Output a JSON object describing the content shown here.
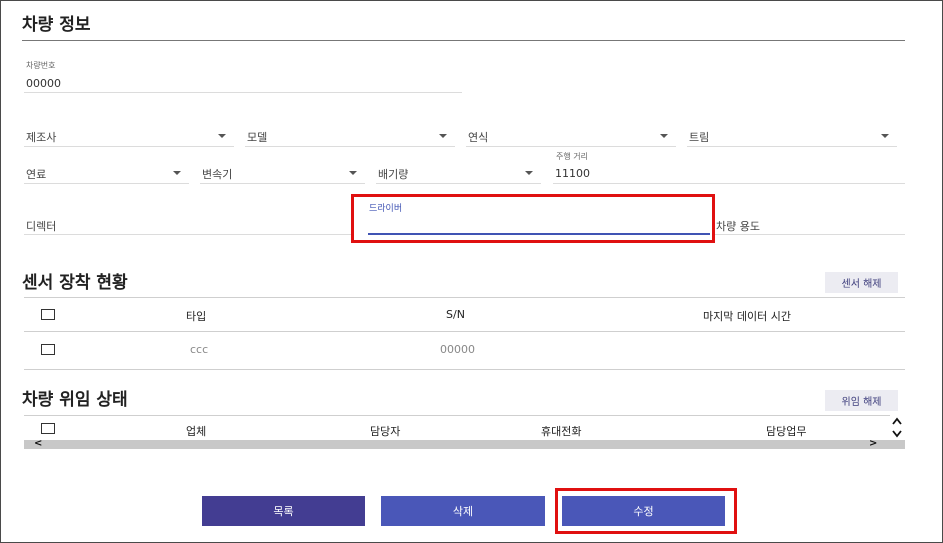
{
  "vehicle_info": {
    "title": "차량 정보",
    "plate": {
      "label": "차량번호",
      "value": "00000"
    },
    "manufacturer": {
      "label": "제조사"
    },
    "model": {
      "label": "모델"
    },
    "year": {
      "label": "연식"
    },
    "trim": {
      "label": "트림"
    },
    "fuel": {
      "label": "연료"
    },
    "transmission": {
      "label": "변속기"
    },
    "displacement": {
      "label": "배기량"
    },
    "mileage": {
      "label": "주행 거리",
      "value": "11100"
    },
    "director": {
      "label": "디렉터"
    },
    "driver": {
      "label": "드라이버",
      "value": ""
    },
    "usage": {
      "label": "차량 용도"
    }
  },
  "sensor": {
    "title": "센서 장착 현황",
    "release_label": "센서 해제",
    "columns": [
      "타입",
      "S/N",
      "마지막 데이터 시간"
    ],
    "rows": [
      {
        "type": "ccc",
        "sn": "00000",
        "last_time": ""
      }
    ]
  },
  "delegation": {
    "title": "차량 위임 상태",
    "release_label": "위임 해제",
    "columns": [
      "업체",
      "담당자",
      "휴대전화",
      "담당업무"
    ]
  },
  "actions": {
    "list_label": "목록",
    "delete_label": "삭제",
    "edit_label": "수정"
  },
  "colors": {
    "list_button": "#433d92",
    "delete_button": "#4a57b8",
    "edit_button": "#4a57b8",
    "highlight": "#e01010",
    "focus_underline": "#4054b4"
  }
}
